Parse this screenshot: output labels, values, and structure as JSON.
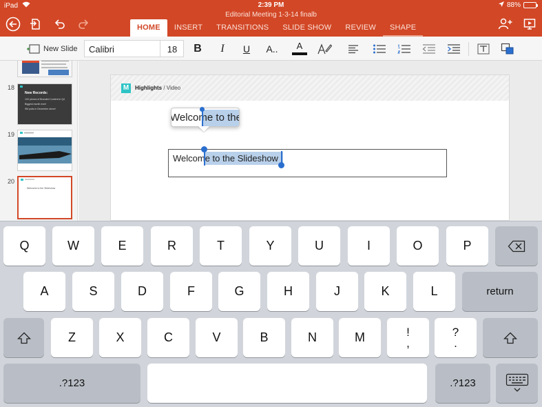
{
  "status": {
    "device": "iPad",
    "time": "2:39 PM",
    "battery": "88%",
    "battery_level": 0.88
  },
  "document": {
    "title": "Editorial Meeting 1-3-14 finalb"
  },
  "tabs": [
    {
      "label": "HOME",
      "active": true
    },
    {
      "label": "INSERT"
    },
    {
      "label": "TRANSITIONS"
    },
    {
      "label": "SLIDE SHOW"
    },
    {
      "label": "REVIEW"
    },
    {
      "label": "SHAPE"
    }
  ],
  "ribbon": {
    "new_slide": "New Slide",
    "font_name": "Calibri",
    "font_size": "18",
    "bold": "B",
    "italic": "I",
    "underline": "U",
    "more_format": "A..",
    "font_color": "A",
    "accent": "#d24726"
  },
  "thumbnails": [
    {
      "number": "18",
      "title": "New Records:",
      "lines": [
        "10X pieces of Branded Content in Q4",
        "Biggest month ever!",
        "9M pubs in December alone!"
      ]
    },
    {
      "number": "19"
    },
    {
      "number": "20",
      "selected": true,
      "text": "Welcome to the Slideshow"
    }
  ],
  "slide": {
    "logo": "M",
    "crumb_section": "Highlights",
    "crumb_sep": " / ",
    "crumb_page": "Video",
    "magnifier_text": "Welcome to the",
    "textbox_text": "Welcome to the Slideshow"
  },
  "keyboard": {
    "row1": [
      "Q",
      "W",
      "E",
      "R",
      "T",
      "Y",
      "U",
      "I",
      "O",
      "P"
    ],
    "row2": [
      "A",
      "S",
      "D",
      "F",
      "G",
      "H",
      "J",
      "K",
      "L"
    ],
    "row3": [
      "Z",
      "X",
      "C",
      "V",
      "B",
      "N",
      "M"
    ],
    "excl_top": "!",
    "excl_bottom": ",",
    "quest_top": "?",
    "quest_bottom": ".",
    "return": "return",
    "numbers": ".?123"
  }
}
